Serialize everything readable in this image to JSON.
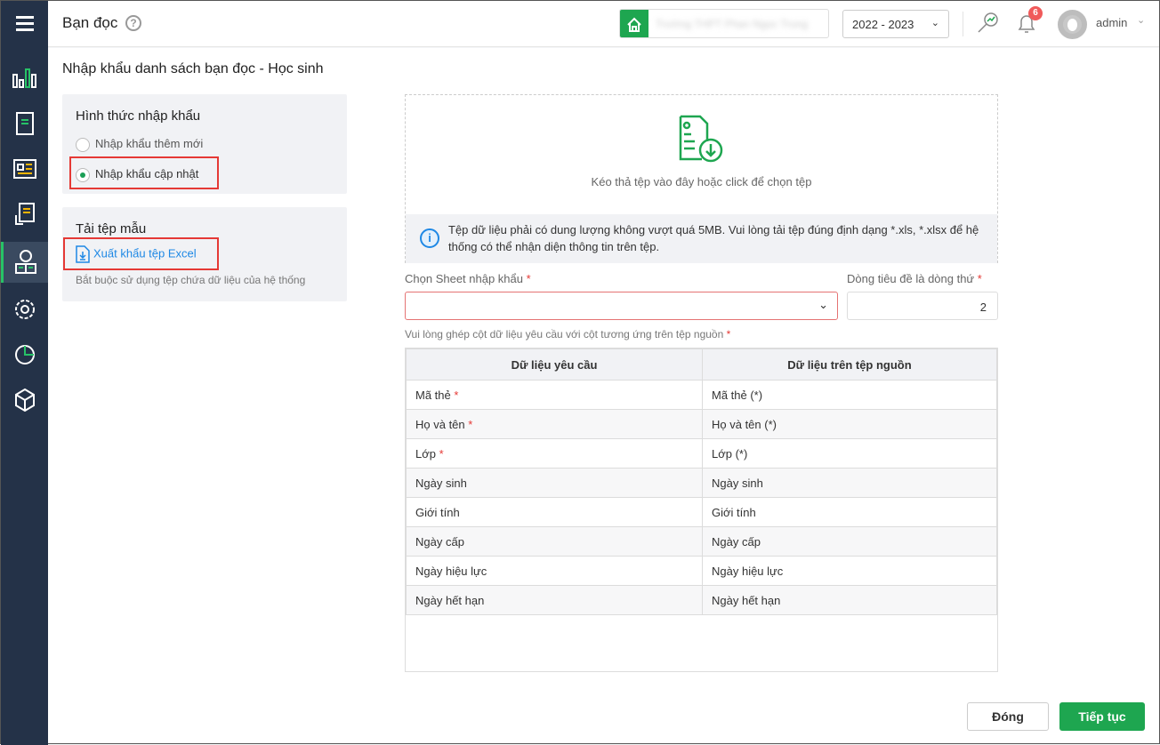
{
  "header": {
    "title": "Bạn đọc",
    "school_name": "Trường THPT Phan Ngọc Trung",
    "school_year": "2022 - 2023",
    "notification_count": "6",
    "user": "admin"
  },
  "page": {
    "title": "Nhập khẩu danh sách bạn đọc - Học sinh"
  },
  "import_type": {
    "title": "Hình thức nhập khẩu",
    "options": [
      {
        "label": "Nhập khẩu thêm mới",
        "selected": false
      },
      {
        "label": "Nhập khẩu cập nhật",
        "selected": true
      }
    ]
  },
  "template": {
    "title": "Tải tệp mẫu",
    "link": "Xuất khẩu tệp Excel",
    "note": "Bắt buộc sử dụng tệp chứa dữ liệu của hệ thống"
  },
  "dropzone": {
    "text": "Kéo thả tệp vào đây hoặc click để chọn tệp",
    "info": "Tệp dữ liệu phải có dung lượng không vượt quá 5MB. Vui lòng tải tệp đúng định dạng *.xls, *.xlsx để hệ thống có thể nhận diện thông tin trên tệp."
  },
  "form": {
    "sheet_label": "Chọn Sheet nhập khẩu",
    "sheet_value": "",
    "header_row_label": "Dòng tiêu đề là dòng thứ",
    "header_row_value": "2",
    "mapping_label": "Vui lòng ghép cột dữ liệu yêu cầu với cột tương ứng trên tệp nguồn",
    "required_mark": "*"
  },
  "table": {
    "headers": [
      "Dữ liệu yêu cầu",
      "Dữ liệu trên tệp nguồn"
    ],
    "rows": [
      {
        "required": "Mã thẻ",
        "req": "*",
        "source": "Mã thẻ (*)"
      },
      {
        "required": "Họ và tên",
        "req": "*",
        "source": "Họ và tên (*)"
      },
      {
        "required": "Lớp",
        "req": "*",
        "source": "Lớp (*)"
      },
      {
        "required": "Ngày sinh",
        "req": "",
        "source": "Ngày sinh"
      },
      {
        "required": "Giới tính",
        "req": "",
        "source": "Giới tính"
      },
      {
        "required": "Ngày cấp",
        "req": "",
        "source": "Ngày cấp"
      },
      {
        "required": "Ngày hiệu lực",
        "req": "",
        "source": "Ngày hiệu lực"
      },
      {
        "required": "Ngày hết hạn",
        "req": "",
        "source": "Ngày hết hạn"
      }
    ]
  },
  "buttons": {
    "close": "Đóng",
    "next": "Tiếp tục"
  },
  "colors": {
    "sidebar": "#243248",
    "accent": "#1ea650",
    "danger": "#e53935",
    "link": "#1e88e5"
  }
}
